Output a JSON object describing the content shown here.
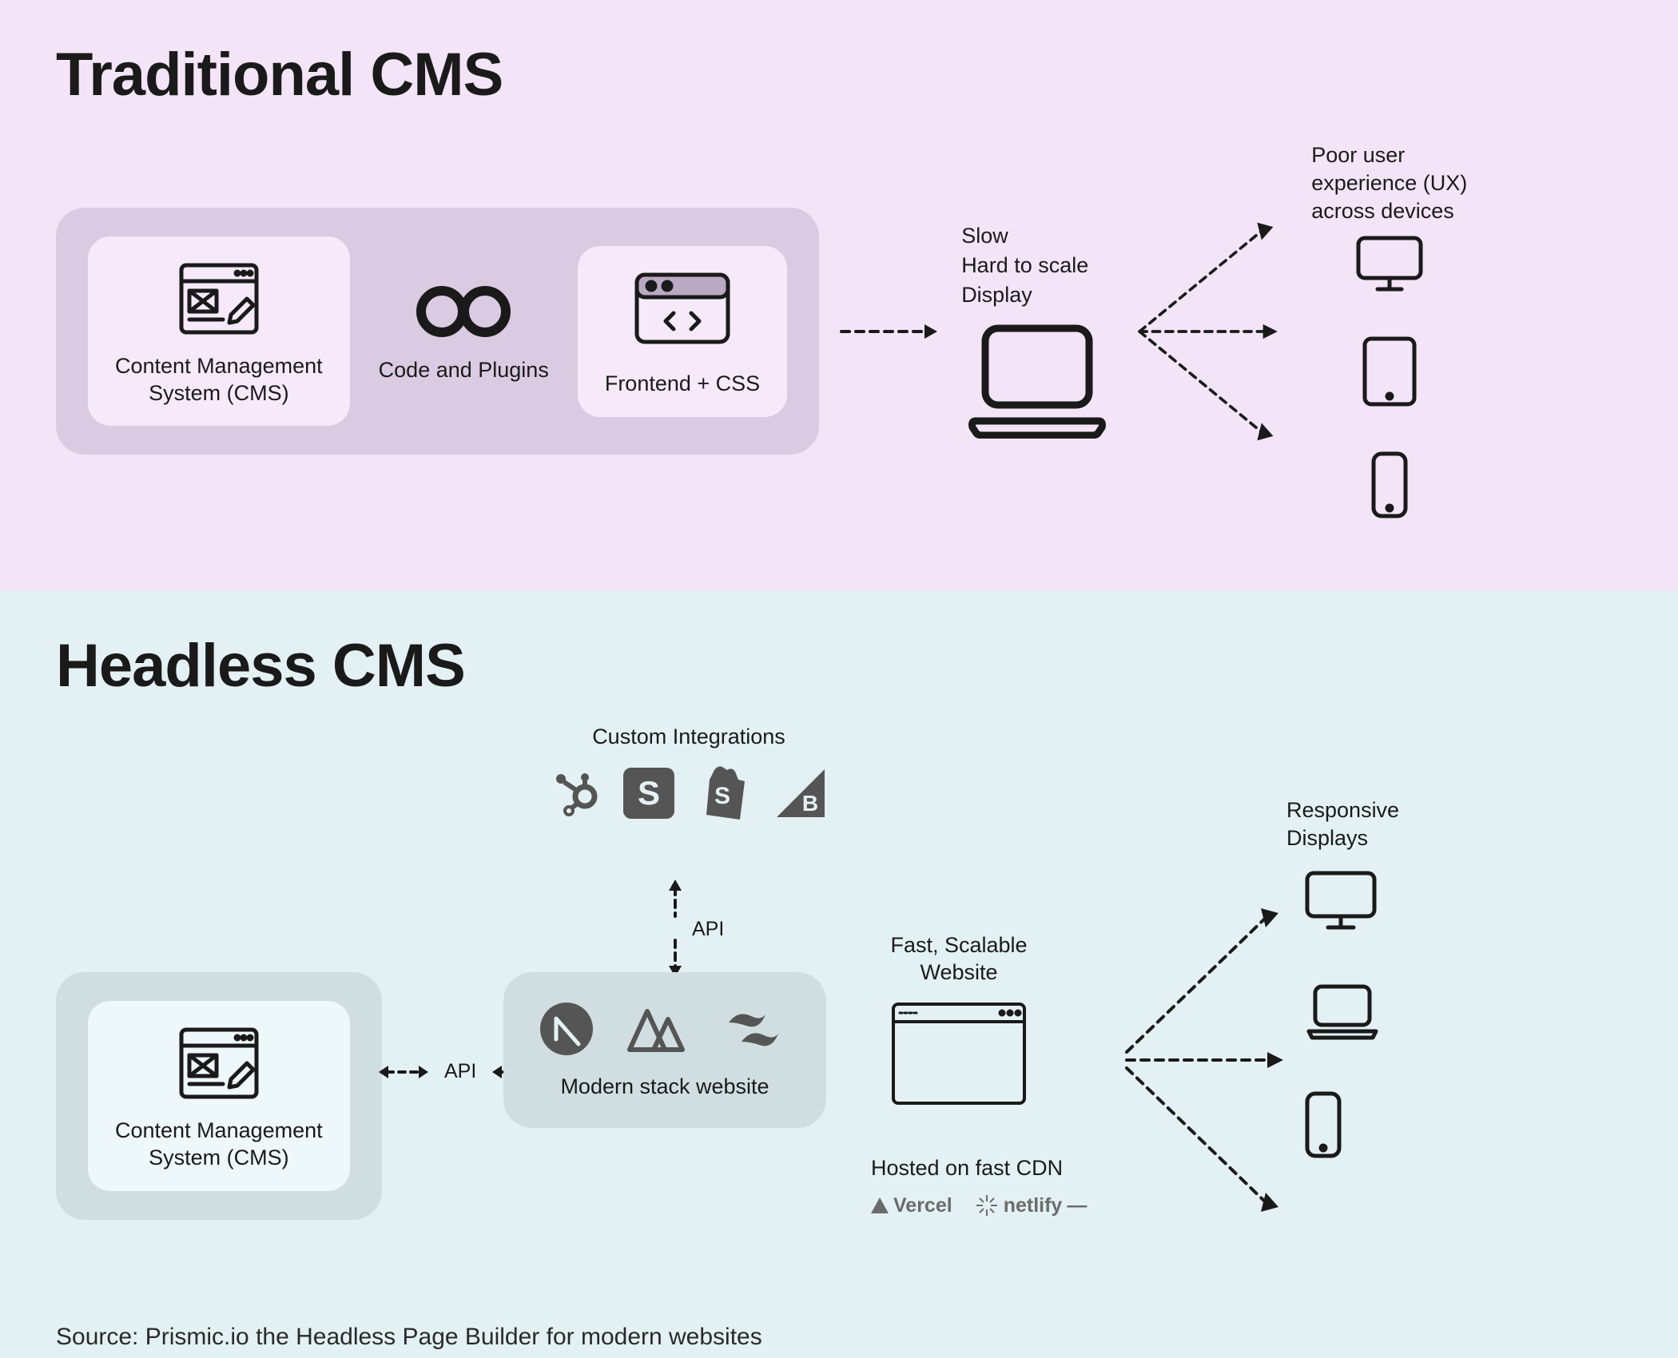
{
  "traditional": {
    "title": "Traditional CMS",
    "cms_label": "Content Management\nSystem (CMS)",
    "code_label": "Code and Plugins",
    "frontend_label": "Frontend + CSS",
    "display_notes": {
      "line1": "Slow",
      "line2": "Hard to scale",
      "line3": "Display"
    },
    "devices_header": "Poor user\nexperience (UX)\nacross devices"
  },
  "headless": {
    "title": "Headless CMS",
    "integrations_label": "Custom Integrations",
    "cms_label": "Content Management\nSystem (CMS)",
    "api_label": "API",
    "stack_label": "Modern stack website",
    "website_label": "Fast, Scalable\nWebsite",
    "cdn_label": "Hosted on fast CDN",
    "cdn_logos": {
      "vercel": "Vercel",
      "netlify": "netlify"
    },
    "devices_header": "Responsive\nDisplays"
  },
  "source": "Source: Prismic.io the Headless Page Builder for modern websites"
}
